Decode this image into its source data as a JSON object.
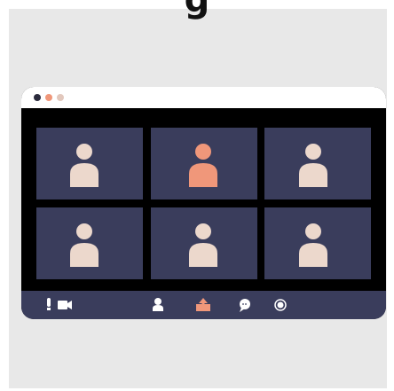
{
  "title_partial": "g",
  "colors": {
    "background": "#e8e8e8",
    "window_frame": "#000000",
    "title_bar": "#ffffff",
    "tile": "#3a3d5c",
    "participant": "#ecd8cc",
    "active_participant": "#f0977a",
    "toolbar": "#3a3d5c",
    "toolbar_icon": "#ffffff",
    "share_icon": "#f0977a"
  },
  "window_controls": [
    "close-dot",
    "minimize-dot",
    "maximize-dot"
  ],
  "participants": [
    {
      "icon": "user-silhouette-icon",
      "active": false
    },
    {
      "icon": "user-silhouette-icon",
      "active": true
    },
    {
      "icon": "user-silhouette-icon",
      "active": false
    },
    {
      "icon": "user-silhouette-icon",
      "active": false
    },
    {
      "icon": "user-silhouette-icon",
      "active": false
    },
    {
      "icon": "user-silhouette-icon",
      "active": false
    }
  ],
  "toolbar": {
    "left": [
      "microphone-icon",
      "video-camera-icon"
    ],
    "center": [
      "participants-icon",
      "share-screen-icon",
      "chat-icon",
      "record-icon"
    ]
  }
}
